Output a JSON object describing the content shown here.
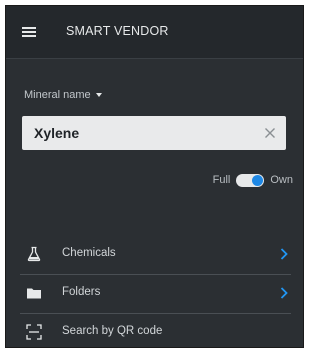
{
  "appbar": {
    "title": "SMART VENDOR",
    "menu_icon": "hamburger-menu-icon"
  },
  "search": {
    "field_label": "Mineral name",
    "value": "Xylene",
    "clear_icon": "close-icon"
  },
  "toggle": {
    "left_label": "Full",
    "right_label": "Own",
    "selected": "Own"
  },
  "menu": {
    "items": [
      {
        "label": "Chemicals",
        "icon": "flask-icon",
        "has_chevron": true
      },
      {
        "label": "Folders",
        "icon": "folder-icon",
        "has_chevron": true
      },
      {
        "label": "Search by QR code",
        "icon": "qr-scan-icon",
        "has_chevron": false
      }
    ]
  },
  "colors": {
    "background": "#2b2f33",
    "appbar": "#24282c",
    "accent": "#1e88e5",
    "input_background": "#e9eaeb"
  }
}
